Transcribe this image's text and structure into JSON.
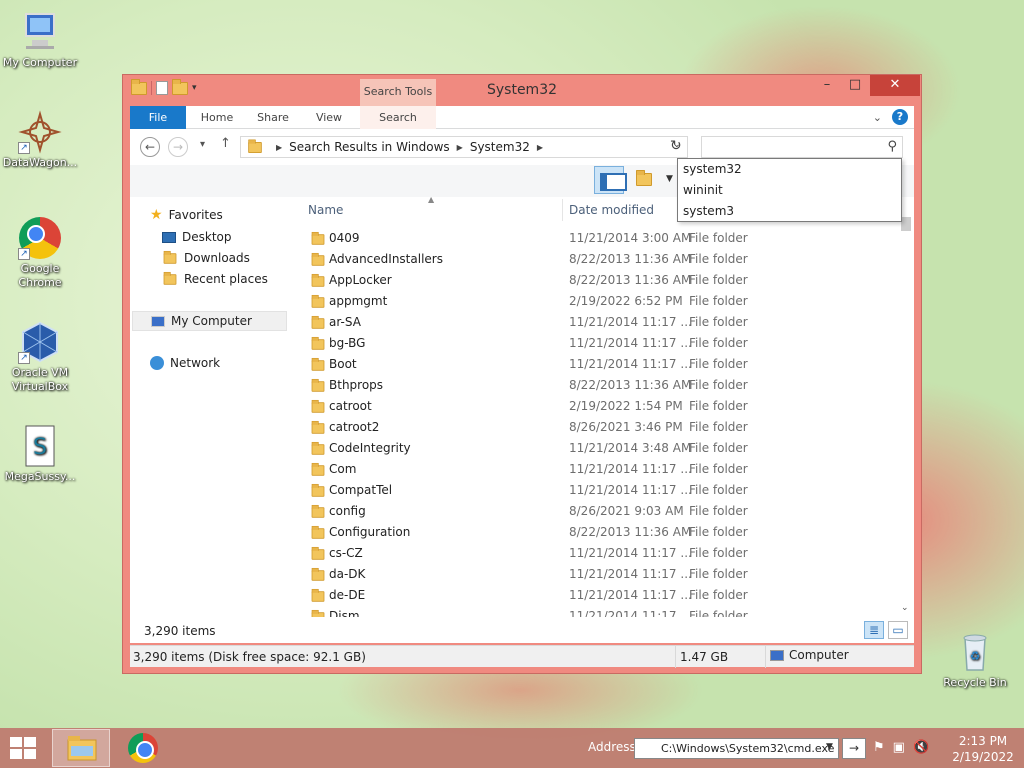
{
  "desktop": {
    "icons": [
      {
        "label": "My Computer",
        "icon": "computer-icon"
      },
      {
        "label": "DataWagon...",
        "icon": "datawagon-icon"
      },
      {
        "label": "Google Chrome",
        "icon": "chrome-icon"
      },
      {
        "label": "Oracle VM VirtualBox",
        "icon": "virtualbox-icon"
      },
      {
        "label": "MegaSussy...",
        "icon": "script-file-icon"
      },
      {
        "label": "Recycle Bin",
        "icon": "recycle-bin-icon"
      }
    ]
  },
  "window": {
    "title": "System32",
    "context_tab_group": "Search Tools",
    "controls": {
      "minimize": "–",
      "maximize": "□",
      "close": "✕"
    }
  },
  "ribbon": {
    "tabs": [
      {
        "label": "File",
        "active": true
      },
      {
        "label": "Home"
      },
      {
        "label": "Share"
      },
      {
        "label": "View"
      },
      {
        "label": "Search"
      }
    ]
  },
  "address": {
    "crumbs": [
      "Search Results in Windows",
      "System32"
    ],
    "search_value": ""
  },
  "suggestions": [
    "system32",
    "wininit",
    "system3"
  ],
  "navpane": {
    "items": [
      {
        "label": "Favorites",
        "icon": "star-icon",
        "level": 0
      },
      {
        "label": "Desktop",
        "icon": "desktop-icon",
        "level": 1
      },
      {
        "label": "Downloads",
        "icon": "downloads-icon",
        "level": 1
      },
      {
        "label": "Recent places",
        "icon": "recent-places-icon",
        "level": 1
      },
      {
        "label": "My Computer",
        "icon": "computer-icon",
        "level": 0,
        "selected": true
      },
      {
        "label": "Network",
        "icon": "network-icon",
        "level": 0
      }
    ]
  },
  "filelist": {
    "columns": {
      "name": "Name",
      "date": "Date modified"
    },
    "rows": [
      {
        "name": "0409",
        "date": "11/21/2014 3:00 AM",
        "type": "File folder"
      },
      {
        "name": "AdvancedInstallers",
        "date": "8/22/2013 11:36 AM",
        "type": "File folder"
      },
      {
        "name": "AppLocker",
        "date": "8/22/2013 11:36 AM",
        "type": "File folder"
      },
      {
        "name": "appmgmt",
        "date": "2/19/2022 6:52 PM",
        "type": "File folder"
      },
      {
        "name": "ar-SA",
        "date": "11/21/2014 11:17 ...",
        "type": "File folder"
      },
      {
        "name": "bg-BG",
        "date": "11/21/2014 11:17 ...",
        "type": "File folder"
      },
      {
        "name": "Boot",
        "date": "11/21/2014 11:17 ...",
        "type": "File folder"
      },
      {
        "name": "Bthprops",
        "date": "8/22/2013 11:36 AM",
        "type": "File folder"
      },
      {
        "name": "catroot",
        "date": "2/19/2022 1:54 PM",
        "type": "File folder"
      },
      {
        "name": "catroot2",
        "date": "8/26/2021 3:46 PM",
        "type": "File folder"
      },
      {
        "name": "CodeIntegrity",
        "date": "11/21/2014 3:48 AM",
        "type": "File folder"
      },
      {
        "name": "Com",
        "date": "11/21/2014 11:17 ...",
        "type": "File folder"
      },
      {
        "name": "CompatTel",
        "date": "11/21/2014 11:17 ...",
        "type": "File folder"
      },
      {
        "name": "config",
        "date": "8/26/2021 9:03 AM",
        "type": "File folder"
      },
      {
        "name": "Configuration",
        "date": "8/22/2013 11:36 AM",
        "type": "File folder"
      },
      {
        "name": "cs-CZ",
        "date": "11/21/2014 11:17 ...",
        "type": "File folder"
      },
      {
        "name": "da-DK",
        "date": "11/21/2014 11:17 ...",
        "type": "File folder"
      },
      {
        "name": "de-DE",
        "date": "11/21/2014 11:17 ...",
        "type": "File folder"
      },
      {
        "name": "Dism",
        "date": "11/21/2014 11:17 ...",
        "type": "File folder"
      }
    ]
  },
  "status": {
    "item_count": "3,290 items",
    "details": "3,290 items (Disk free space: 92.1 GB)",
    "size": "1.47 GB",
    "location": "Computer"
  },
  "taskbar": {
    "address_label": "Address",
    "address_value": "C:\\Windows\\System32\\cmd.exe",
    "go_glyph": "→",
    "time": "2:13 PM",
    "date": "2/19/2022"
  },
  "colors": {
    "accent": "#1979ca",
    "window_frame": "#f08a80",
    "close_button": "#c7433a"
  }
}
